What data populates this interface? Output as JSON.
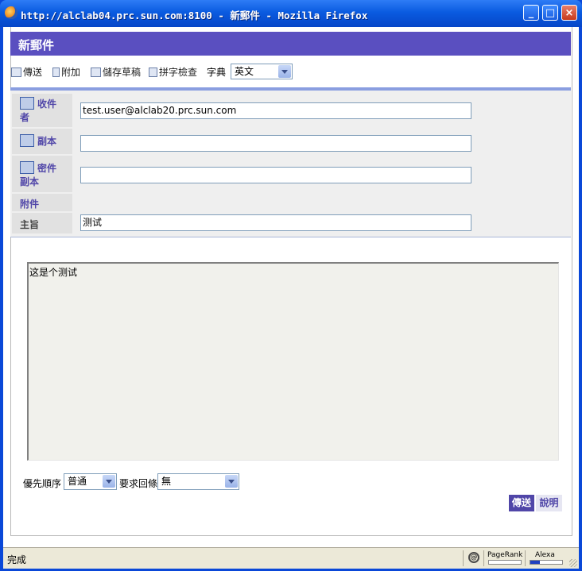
{
  "window": {
    "title": "http://alclab04.prc.sun.com:8100 - 新郵件 - Mozilla Firefox",
    "buttons": {
      "minimize": "_",
      "maximize": "□",
      "close": "×"
    }
  },
  "page": {
    "header_title": "新郵件"
  },
  "toolbar": {
    "send_label": "傳送",
    "attach_label": "附加",
    "save_draft_label": "儲存草稿",
    "spellcheck_label": "拼字檢查",
    "dictionary_label": "字典",
    "dictionary_value": "英文"
  },
  "fields": {
    "to_label_1": "收件",
    "to_label_2": "者",
    "to_value": "test.user@alclab20.prc.sun.com",
    "cc_label": "副本",
    "cc_value": "",
    "bcc_label_1": "密件",
    "bcc_label_2": "副本",
    "bcc_value": "",
    "attachments_label": "附件",
    "subject_label": "主旨",
    "subject_value": "测试"
  },
  "body": {
    "text": "这是个测试"
  },
  "options": {
    "priority_label": "優先順序",
    "priority_value": "普通",
    "receipt_label": "要求回條",
    "receipt_value": "無"
  },
  "actions": {
    "send_label": "傳送",
    "help_label": "說明"
  },
  "statusbar": {
    "status_text": "完成",
    "pagerank_label": "PageRank",
    "alexa_label": "Alexa"
  }
}
